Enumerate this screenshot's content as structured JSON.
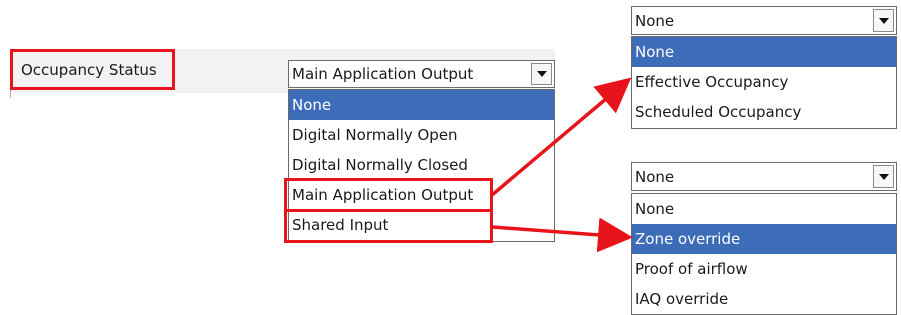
{
  "setting": {
    "label": "Occupancy Status"
  },
  "source_combo": {
    "value": "Main Application Output",
    "options": [
      "None",
      "Digital Normally Open",
      "Digital Normally Closed",
      "Main Application Output",
      "Shared Input"
    ],
    "highlighted_option": "None"
  },
  "main_output_combo": {
    "value": "None",
    "options": [
      "None",
      "Effective Occupancy",
      "Scheduled Occupancy"
    ],
    "highlighted_option": "None"
  },
  "shared_input_combo": {
    "value": "None",
    "options": [
      "None",
      "Zone override",
      "Proof of airflow",
      "IAQ override"
    ],
    "highlighted_option": "Zone override"
  },
  "icons": {
    "dropdown": "chevron-down-icon",
    "connector": "arrow-right-icon"
  },
  "colors": {
    "highlight_border": "#e8141b",
    "selection": "#3d6cb8",
    "arrow": "#e8141b"
  }
}
